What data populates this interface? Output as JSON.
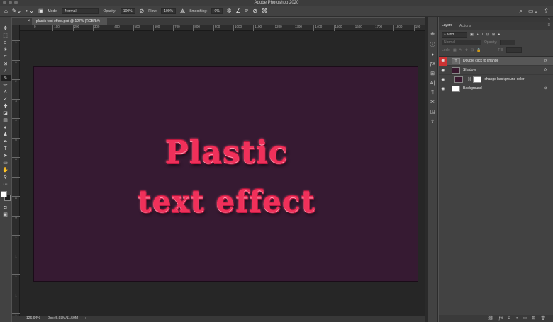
{
  "app": {
    "title": "Adobe Photoshop 2020"
  },
  "options": {
    "mode_label": "Mode:",
    "mode_value": "Normal",
    "opacity_label": "Opacity:",
    "opacity_value": "100%",
    "flow_label": "Flow:",
    "flow_value": "100%",
    "smoothing_label": "Smoothing:",
    "smoothing_value": "0%",
    "angle_value": "0°"
  },
  "document": {
    "tab_title": "plastic text effect.psd @ 127% (RGB/8#)",
    "headline_line1": "Plastic",
    "headline_line2": "text effect"
  },
  "ruler": {
    "h_ticks": [
      "0",
      "100",
      "200",
      "300",
      "400",
      "500",
      "600",
      "700",
      "800",
      "900",
      "1000",
      "1100",
      "1200",
      "1300",
      "1400",
      "1500",
      "1600",
      "1700",
      "1800",
      "190"
    ],
    "v_ticks": [
      "1",
      "0",
      "2",
      "3",
      "4",
      "5",
      "6",
      "7",
      "8",
      "9",
      "1",
      "1",
      "1",
      "1",
      "1"
    ]
  },
  "status": {
    "zoom": "126.94%",
    "doc": "Doc: 5.93M/11.59M"
  },
  "panel": {
    "tabs": [
      "Layers",
      "Actions"
    ],
    "filter_kind": "Kind",
    "blend_mode": "Normal",
    "opacity_label": "Opacity:",
    "lock_label": "Lock:",
    "fill_label": "Fill:",
    "layers": [
      {
        "name": "Double click to change",
        "thumb": "T",
        "fx": "fx"
      },
      {
        "name": "Shadow",
        "thumb": "",
        "fx": "fx"
      },
      {
        "name": "change background color",
        "thumb": "",
        "fx": ""
      },
      {
        "name": "Background",
        "thumb": "",
        "fx": ""
      }
    ]
  }
}
